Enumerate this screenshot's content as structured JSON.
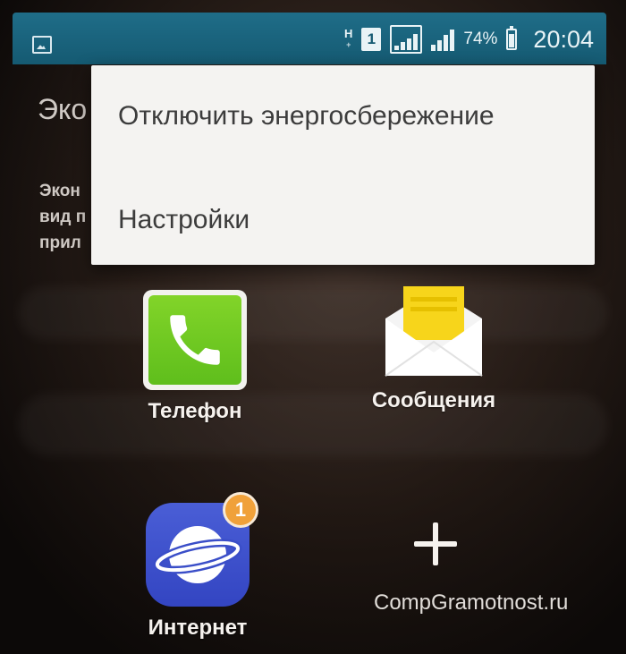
{
  "status_bar": {
    "network_type": "H",
    "network_sub": "+",
    "sim_slot": "1",
    "battery_percent": "74%",
    "time": "20:04"
  },
  "background_screen": {
    "title_partial": "Эко",
    "lines_partial": [
      "Экон",
      "вид п",
      "прил"
    ]
  },
  "popup_menu": {
    "items": [
      {
        "label": "Отключить энергосбережение"
      },
      {
        "label": "Настройки"
      }
    ]
  },
  "apps": [
    {
      "label": "Телефон",
      "icon": "phone-icon"
    },
    {
      "label": "Сообщения",
      "icon": "messages-icon"
    },
    {
      "label": "Интернет",
      "icon": "internet-icon",
      "badge": "1"
    }
  ],
  "add_app": {
    "icon": "plus-icon"
  },
  "watermark": "CompGramotnost.ru",
  "colors": {
    "status_bar": "#1f6d88",
    "phone_green": "#6cc722",
    "messages_yellow": "#f7d51b",
    "internet_blue": "#3e52cc",
    "badge_orange": "#f0a13a"
  }
}
